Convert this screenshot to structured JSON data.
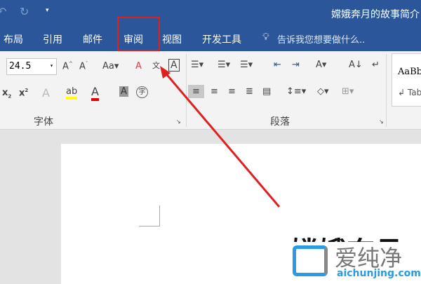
{
  "title": "嫦娥奔月的故事简介",
  "tabs": [
    "布局",
    "引用",
    "邮件",
    "审阅",
    "视图",
    "开发工具"
  ],
  "tell_me": "告诉我您想要做什么..",
  "font_size": "24.5",
  "groups": {
    "font": "字体",
    "paragraph": "段落"
  },
  "styles": {
    "style1": "AaBb",
    "style2": "↲ Tab"
  },
  "doc_heading": "嫦娥奔月",
  "watermark": {
    "brand": "爱纯净",
    "url": "aichunjing.com"
  },
  "colors": {
    "titlebar": "#2b579a",
    "highlight_box": "#e02020",
    "arrow": "#e02020"
  }
}
